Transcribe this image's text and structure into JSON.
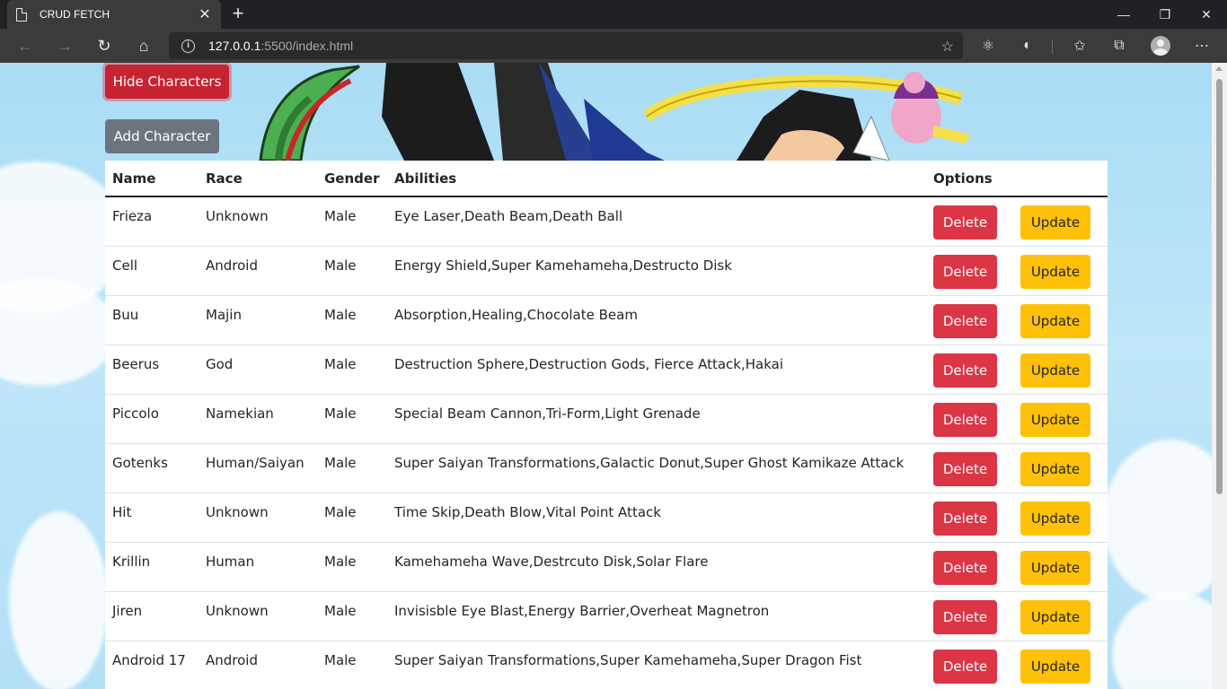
{
  "browser": {
    "tab_title": "CRUD FETCH",
    "url_host": "127.0.0.1",
    "url_rest": ":5500/index.html"
  },
  "page": {
    "hide_button": "Hide Characters",
    "add_button": "Add Character",
    "columns": [
      "Name",
      "Race",
      "Gender",
      "Abilities",
      "Options"
    ],
    "delete_label": "Delete",
    "update_label": "Update",
    "rows": [
      {
        "name": "Frieza",
        "race": "Unknown",
        "gender": "Male",
        "abilities": "Eye Laser,Death Beam,Death Ball"
      },
      {
        "name": "Cell",
        "race": "Android",
        "gender": "Male",
        "abilities": "Energy Shield,Super Kamehameha,Destructo Disk"
      },
      {
        "name": "Buu",
        "race": "Majin",
        "gender": "Male",
        "abilities": "Absorption,Healing,Chocolate Beam"
      },
      {
        "name": "Beerus",
        "race": "God",
        "gender": "Male",
        "abilities": "Destruction Sphere,Destruction Gods, Fierce Attack,Hakai"
      },
      {
        "name": "Piccolo",
        "race": "Namekian",
        "gender": "Male",
        "abilities": "Special Beam Cannon,Tri-Form,Light Grenade"
      },
      {
        "name": "Gotenks",
        "race": "Human/Saiyan",
        "gender": "Male",
        "abilities": "Super Saiyan Transformations,Galactic Donut,Super Ghost Kamikaze Attack"
      },
      {
        "name": "Hit",
        "race": "Unknown",
        "gender": "Male",
        "abilities": "Time Skip,Death Blow,Vital Point Attack"
      },
      {
        "name": "Krillin",
        "race": "Human",
        "gender": "Male",
        "abilities": "Kamehameha Wave,Destrcuto Disk,Solar Flare"
      },
      {
        "name": "Jiren",
        "race": "Unknown",
        "gender": "Male",
        "abilities": "Invisisble Eye Blast,Energy Barrier,Overheat Magnetron"
      },
      {
        "name": "Android 17",
        "race": "Android",
        "gender": "Male",
        "abilities": "Super Saiyan Transformations,Super Kamehameha,Super Dragon Fist"
      }
    ]
  }
}
